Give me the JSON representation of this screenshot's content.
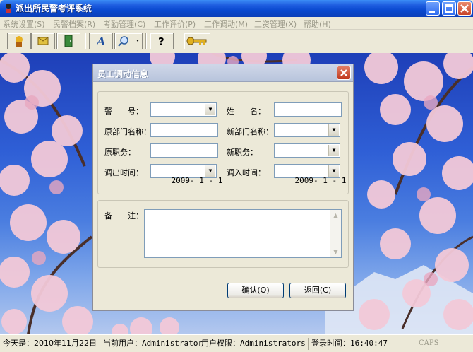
{
  "window": {
    "title": "派出所民警考评系统"
  },
  "menu": [
    "系统设置(S)",
    "民警档案(R)",
    "考勤管理(C)",
    "工作评价(P)",
    "工作调动(M)",
    "工资管理(X)",
    "帮助(H)"
  ],
  "toolbar": {
    "icons": [
      "officer-icon",
      "archive-icon",
      "door-icon",
      "font-icon",
      "search-icon",
      "help-icon",
      "key-icon"
    ]
  },
  "dialog": {
    "title": "员工调动信息",
    "labels": {
      "police_no": "警　　号：",
      "name": "姓　　名：",
      "orig_dept": "原部门名称：",
      "new_dept": "新部门名称：",
      "orig_duty": "原职务：",
      "new_duty": "新职务：",
      "out_time": "调出时间：",
      "in_time": "调入时间：",
      "remark": "备　　注："
    },
    "values": {
      "police_no": "",
      "name": "",
      "orig_dept": "",
      "new_dept": "",
      "orig_duty": "",
      "new_duty": "",
      "out_time": "2009- 1 - 1",
      "in_time": "2009- 1 - 1",
      "remark": ""
    },
    "buttons": {
      "ok": "确认(O)",
      "back": "返回(C)"
    }
  },
  "status": {
    "today": "今天是：2010年11月22日",
    "user": "当前用户：Administrator",
    "rights": "用户权限：Administrators",
    "login": "登录时间：16:40:47",
    "caps": "CAPS"
  },
  "colors": {
    "titlebar": "#0a49d0",
    "sky": "#2f5fd6",
    "blossom": "#f3c9d8"
  }
}
